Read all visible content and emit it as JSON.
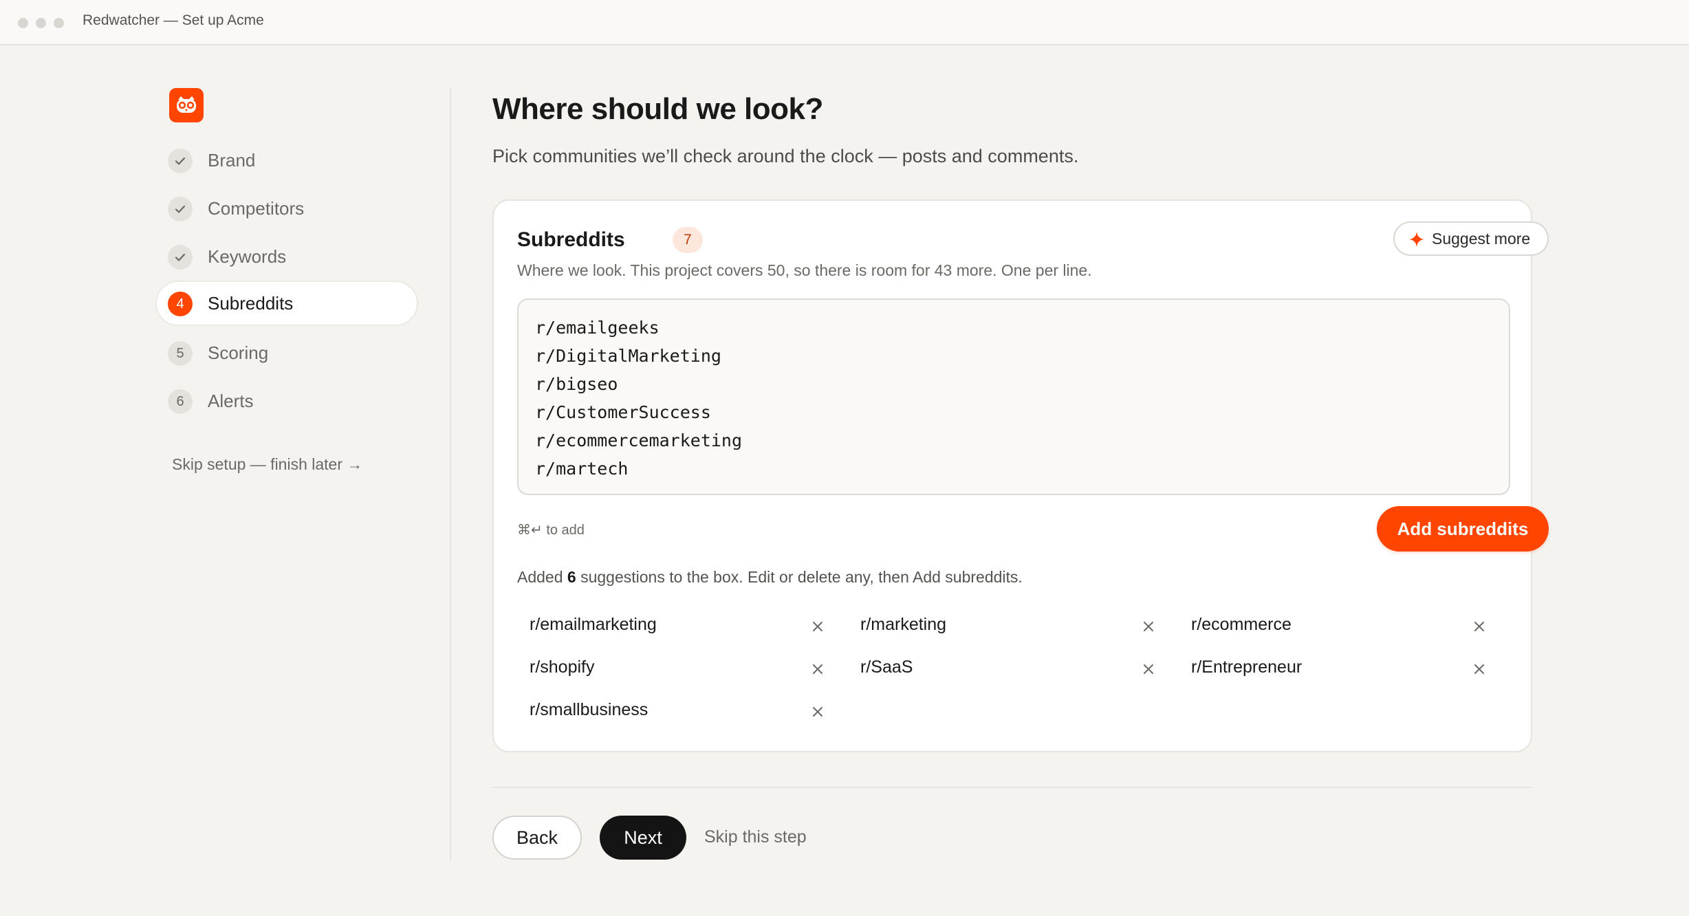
{
  "window": {
    "title": "Redwatcher — Set up Acme"
  },
  "sidebar": {
    "steps": [
      {
        "marker": "check",
        "label": "Brand",
        "state": "done"
      },
      {
        "marker": "check",
        "label": "Competitors",
        "state": "done"
      },
      {
        "marker": "check",
        "label": "Keywords",
        "state": "done"
      },
      {
        "marker": "4",
        "label": "Subreddits",
        "state": "active"
      },
      {
        "marker": "5",
        "label": "Scoring",
        "state": "upcoming"
      },
      {
        "marker": "6",
        "label": "Alerts",
        "state": "upcoming"
      }
    ],
    "skip_setup": "Skip setup — finish later →"
  },
  "main": {
    "title": "Where should we look?",
    "subtitle": "Pick communities we’ll check around the clock — posts and comments.",
    "card": {
      "title": "Subreddits",
      "count": "7",
      "suggest_label": "Suggest more",
      "description": "Where we look. This project covers 50, so there is room for 43 more. One per line.",
      "textarea_lines": [
        "r/emailgeeks",
        "r/DigitalMarketing",
        "r/bigseo",
        "r/CustomerSuccess",
        "r/ecommercemarketing",
        "r/martech"
      ],
      "shortcut_hint": "⌘↵ to add",
      "add_label": "Add subreddits",
      "added_prefix": "Added ",
      "added_count": "6",
      "added_suffix": " suggestions to the box. Edit or delete any, then Add subreddits.",
      "suggestions": [
        "r/emailmarketing",
        "r/marketing",
        "r/ecommerce",
        "r/shopify",
        "r/SaaS",
        "r/Entrepreneur",
        "r/smallbusiness"
      ]
    },
    "footer": {
      "back_label": "Back",
      "next_label": "Next",
      "skip_label": "Skip this step"
    }
  },
  "colors": {
    "accent": "#ff4500",
    "background": "#f4f3f0",
    "card": "#ffffff",
    "primary_button": "#141414"
  }
}
